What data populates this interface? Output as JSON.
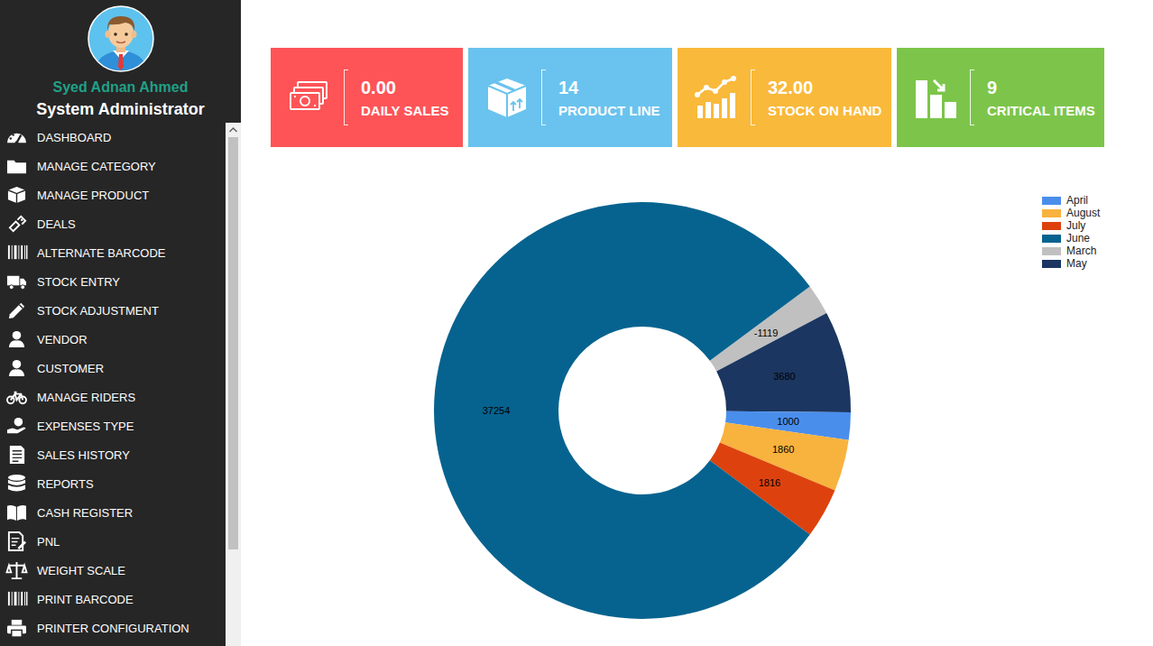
{
  "profile": {
    "name": "Syed Adnan Ahmed",
    "role": "System Administrator"
  },
  "sidebar": {
    "items": [
      {
        "label": "DASHBOARD"
      },
      {
        "label": "MANAGE CATEGORY"
      },
      {
        "label": "MANAGE PRODUCT"
      },
      {
        "label": "DEALS"
      },
      {
        "label": "ALTERNATE BARCODE"
      },
      {
        "label": "STOCK ENTRY"
      },
      {
        "label": "STOCK ADJUSTMENT"
      },
      {
        "label": "VENDOR"
      },
      {
        "label": "CUSTOMER"
      },
      {
        "label": "MANAGE RIDERS"
      },
      {
        "label": "EXPENSES TYPE"
      },
      {
        "label": "SALES HISTORY"
      },
      {
        "label": "REPORTS"
      },
      {
        "label": "CASH REGISTER"
      },
      {
        "label": "PNL"
      },
      {
        "label": "WEIGHT SCALE"
      },
      {
        "label": "PRINT BARCODE"
      },
      {
        "label": "PRINTER CONFIGURATION"
      }
    ],
    "scrollbar": {
      "level": 0.81
    }
  },
  "cards": [
    {
      "value": "0.00",
      "label": "DAILY SALES",
      "color": "#fe5457"
    },
    {
      "value": "14",
      "label": "PRODUCT LINE",
      "color": "#69c3ee"
    },
    {
      "value": "32.00",
      "label": "STOCK ON HAND",
      "color": "#f9b93b"
    },
    {
      "value": "9",
      "label": "CRITICAL ITEMS",
      "color": "#7cc54a"
    }
  ],
  "chart": {
    "legend": [
      {
        "label": "April",
        "color": "#4a8eec"
      },
      {
        "label": "August",
        "color": "#f8b23e"
      },
      {
        "label": "July",
        "color": "#dd420e"
      },
      {
        "label": "June",
        "color": "#06638f"
      },
      {
        "label": "March",
        "color": "#c0c0c0"
      },
      {
        "label": "May",
        "color": "#1b3660"
      }
    ],
    "slices": [
      {
        "series": "March",
        "value": -1119,
        "label": "-1119"
      },
      {
        "series": "May",
        "value": 3680,
        "label": "3680"
      },
      {
        "series": "April",
        "value": 1000,
        "label": "1000"
      },
      {
        "series": "August",
        "value": 1860,
        "label": "1860"
      },
      {
        "series": "July",
        "value": 1816,
        "label": "1816"
      },
      {
        "series": "June",
        "value": 37254,
        "label": "37254"
      }
    ]
  }
}
